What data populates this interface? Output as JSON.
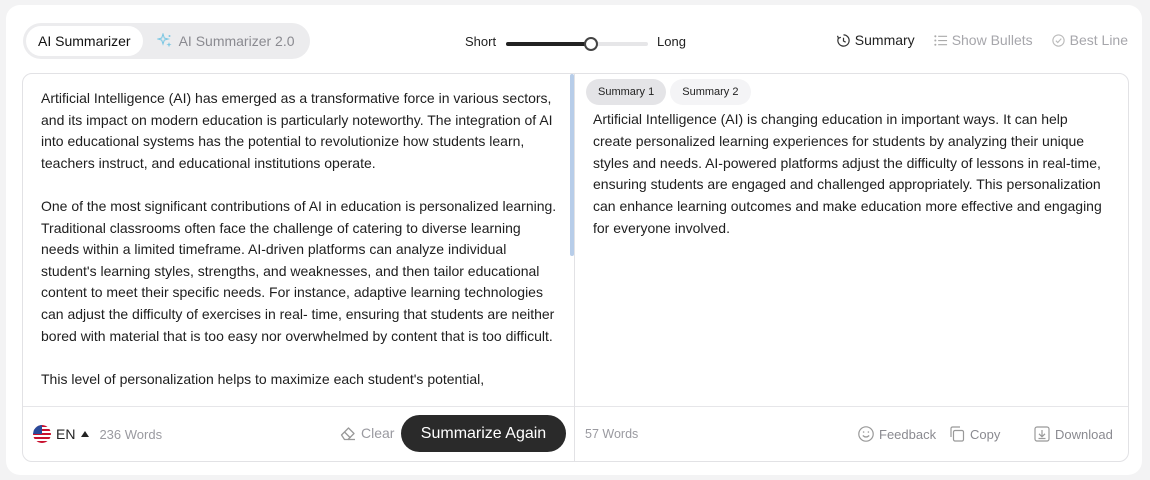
{
  "modes": [
    {
      "label": "AI Summarizer",
      "active": true
    },
    {
      "label": "AI Summarizer 2.0",
      "active": false,
      "icon": "sparkle-icon"
    }
  ],
  "length": {
    "short_label": "Short",
    "long_label": "Long",
    "value": 0.6
  },
  "formats": [
    {
      "label": "Summary",
      "icon": "summary-icon",
      "active": true
    },
    {
      "label": "Show Bullets",
      "icon": "bullets-icon",
      "active": false
    },
    {
      "label": "Best Line",
      "icon": "best-line-icon",
      "active": false
    }
  ],
  "input": {
    "paragraphs": [
      "Artificial Intelligence (AI) has emerged as a transformative force in various sectors, and its impact on modern education is particularly noteworthy. The integration of AI into educational systems has the potential to revolutionize how students learn, teachers instruct, and educational institutions operate.",
      "One of the most significant contributions of AI in education is personalized learning. Traditional classrooms often face the challenge of catering to diverse learning needs within a limited timeframe. AI-driven platforms can analyze individual student's learning styles, strengths, and weaknesses, and then tailor educational content to meet their specific needs. For instance, adaptive learning technologies can adjust the difficulty of exercises in real- time, ensuring that students are neither bored with material that is too easy nor overwhelmed by content that is too difficult.",
      "This level of personalization helps to maximize each student's potential,"
    ],
    "language": "EN",
    "word_count": "236 Words",
    "clear_label": "Clear",
    "submit_label": "Summarize Again"
  },
  "output": {
    "tabs": [
      {
        "label": "Summary 1",
        "active": true
      },
      {
        "label": "Summary 2",
        "active": false
      }
    ],
    "text": "Artificial Intelligence (AI) is changing education in important ways. It can help create personalized learning experiences for students by analyzing their unique styles and needs. AI-powered platforms adjust the difficulty of lessons in real-time, ensuring students are engaged and challenged appropriately. This personalization can enhance learning outcomes and make education more effective and engaging for everyone involved.",
    "word_count": "57 Words",
    "feedback_label": "Feedback",
    "copy_label": "Copy",
    "download_label": "Download"
  },
  "colors": {
    "accent": "#2a2a2a",
    "scroll_thumb": "#b7cde9",
    "muted": "#9a9aa0"
  }
}
